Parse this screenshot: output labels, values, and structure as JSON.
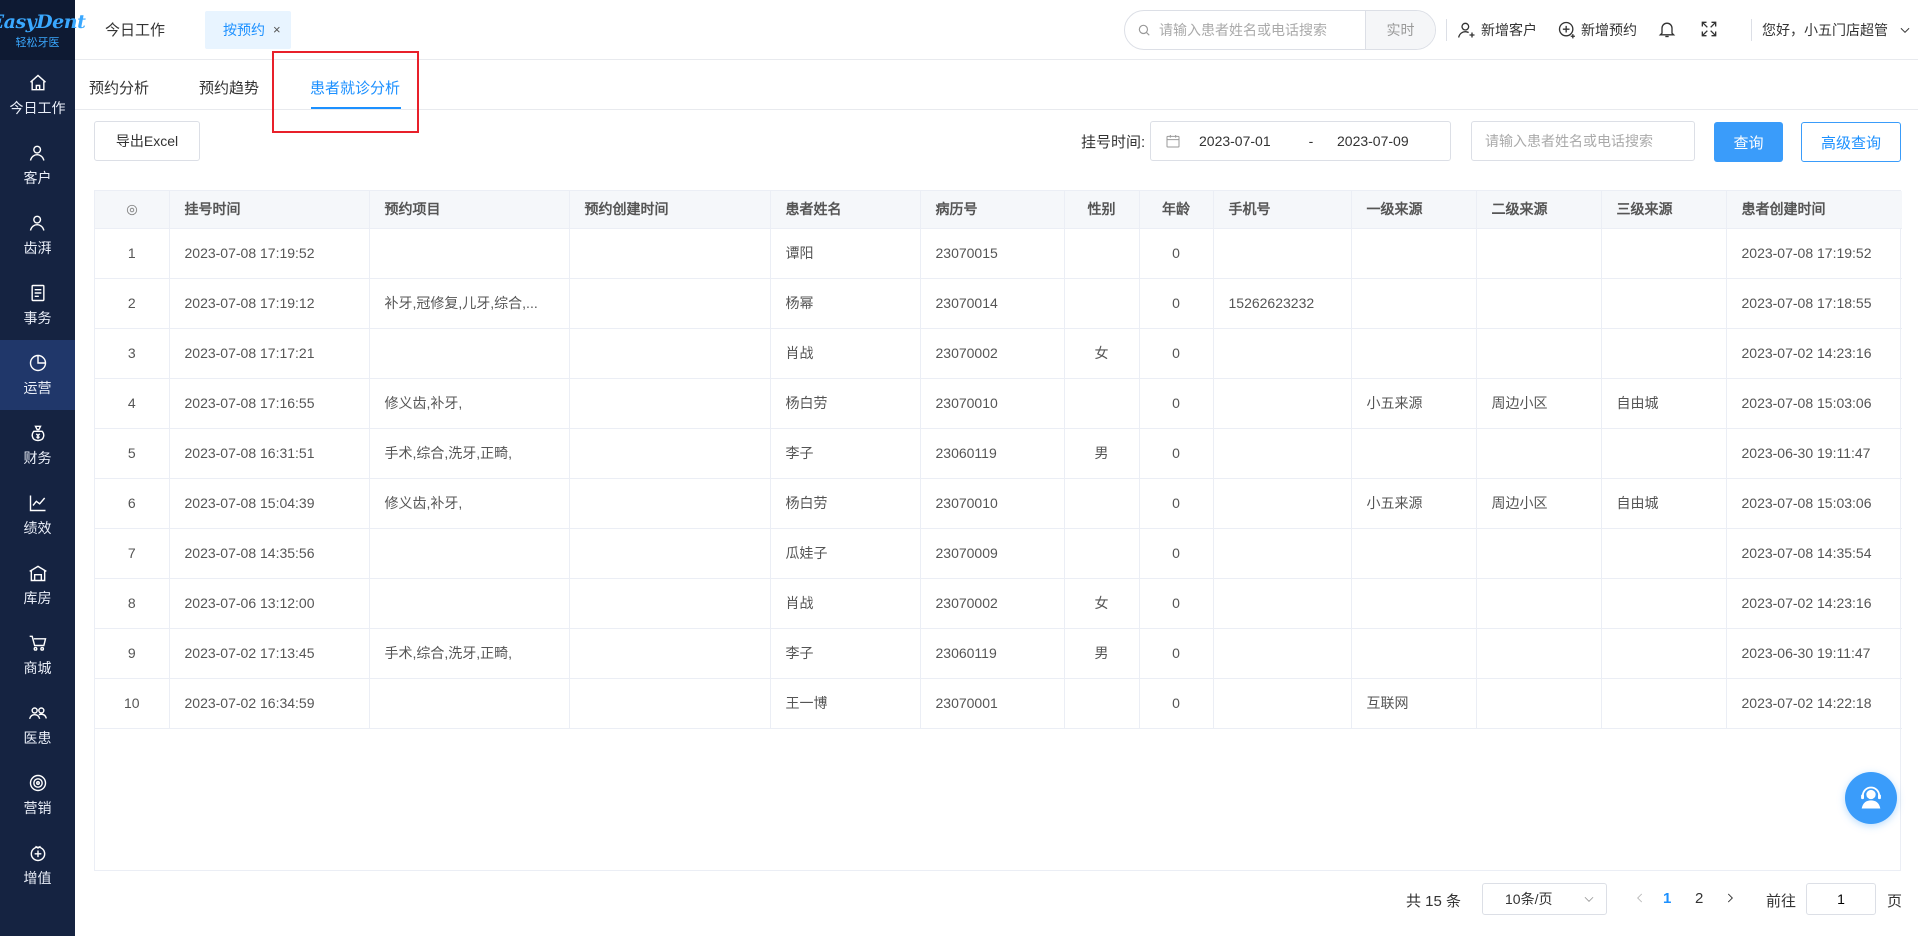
{
  "logo": {
    "brand": "EasyDent",
    "brand_cn": "轻松牙医"
  },
  "sidebar": {
    "items": [
      {
        "label": "今日工作",
        "icon": "home-icon",
        "active": false
      },
      {
        "label": "客户",
        "icon": "user-icon",
        "active": false
      },
      {
        "label": "齿湃",
        "icon": "user-icon",
        "active": false
      },
      {
        "label": "事务",
        "icon": "document-icon",
        "active": false
      },
      {
        "label": "运营",
        "icon": "pie-chart-icon",
        "active": true
      },
      {
        "label": "财务",
        "icon": "money-bag-icon",
        "active": false
      },
      {
        "label": "绩效",
        "icon": "line-chart-icon",
        "active": false
      },
      {
        "label": "库房",
        "icon": "warehouse-icon",
        "active": false
      },
      {
        "label": "商城",
        "icon": "cart-icon",
        "active": false
      },
      {
        "label": "医患",
        "icon": "people-icon",
        "active": false
      },
      {
        "label": "营销",
        "icon": "target-icon",
        "active": false
      },
      {
        "label": "增值",
        "icon": "gift-icon",
        "active": false
      }
    ]
  },
  "topbar": {
    "tab_today": "今日工作",
    "tab_active": "按预约",
    "tab_close": "×",
    "search_placeholder": "请输入患者姓名或电话搜索",
    "search_mode": "实时",
    "add_customer": "新增客户",
    "add_appointment": "新增预约",
    "greeting": "您好，小五门店超管"
  },
  "subtabs": {
    "items": [
      "预约分析",
      "预约趋势",
      "患者就诊分析"
    ],
    "active_index": 2
  },
  "filters": {
    "export_label": "导出Excel",
    "date_label": "挂号时间:",
    "date_start": "2023-07-01",
    "date_sep": "-",
    "date_end": "2023-07-09",
    "search_placeholder": "请输入患者姓名或电话搜索",
    "query_label": "查询",
    "advanced_label": "高级查询"
  },
  "table": {
    "columns": [
      "挂号时间",
      "预约项目",
      "预约创建时间",
      "患者姓名",
      "病历号",
      "性别",
      "年龄",
      "手机号",
      "一级来源",
      "二级来源",
      "三级来源",
      "患者创建时间"
    ],
    "rows": [
      [
        "1",
        "2023-07-08 17:19:52",
        "",
        "",
        "谭阳",
        "23070015",
        "",
        "0",
        "",
        "",
        "",
        "",
        "2023-07-08 17:19:52"
      ],
      [
        "2",
        "2023-07-08 17:19:12",
        "补牙,冠修复,儿牙,综合,...",
        "",
        "杨幂",
        "23070014",
        "",
        "0",
        "15262623232",
        "",
        "",
        "",
        "2023-07-08 17:18:55"
      ],
      [
        "3",
        "2023-07-08 17:17:21",
        "",
        "",
        "肖战",
        "23070002",
        "女",
        "0",
        "",
        "",
        "",
        "",
        "2023-07-02 14:23:16"
      ],
      [
        "4",
        "2023-07-08 17:16:55",
        "修义齿,补牙,",
        "",
        "杨白劳",
        "23070010",
        "",
        "0",
        "",
        "小五来源",
        "周边小区",
        "自由城",
        "2023-07-08 15:03:06"
      ],
      [
        "5",
        "2023-07-08 16:31:51",
        "手术,综合,洗牙,正畸,",
        "",
        "李子",
        "23060119",
        "男",
        "0",
        "",
        "",
        "",
        "",
        "2023-06-30 19:11:47"
      ],
      [
        "6",
        "2023-07-08 15:04:39",
        "修义齿,补牙,",
        "",
        "杨白劳",
        "23070010",
        "",
        "0",
        "",
        "小五来源",
        "周边小区",
        "自由城",
        "2023-07-08 15:03:06"
      ],
      [
        "7",
        "2023-07-08 14:35:56",
        "",
        "",
        "瓜娃子",
        "23070009",
        "",
        "0",
        "",
        "",
        "",
        "",
        "2023-07-08 14:35:54"
      ],
      [
        "8",
        "2023-07-06 13:12:00",
        "",
        "",
        "肖战",
        "23070002",
        "女",
        "0",
        "",
        "",
        "",
        "",
        "2023-07-02 14:23:16"
      ],
      [
        "9",
        "2023-07-02 17:13:45",
        "手术,综合,洗牙,正畸,",
        "",
        "李子",
        "23060119",
        "男",
        "0",
        "",
        "",
        "",
        "",
        "2023-06-30 19:11:47"
      ],
      [
        "10",
        "2023-07-02 16:34:59",
        "",
        "",
        "王一博",
        "23070001",
        "",
        "0",
        "",
        "互联网",
        "",
        "",
        "2023-07-02 14:22:18"
      ]
    ]
  },
  "pagination": {
    "total_label": "共 15 条",
    "page_size": "10条/页",
    "pages": [
      "1",
      "2"
    ],
    "current_page": "1",
    "goto_label": "前往",
    "goto_value": "1",
    "page_suffix": "页"
  },
  "colors": {
    "sidebar_bg": "#152341",
    "accent": "#1c90ff",
    "highlight": "#e8202a"
  }
}
